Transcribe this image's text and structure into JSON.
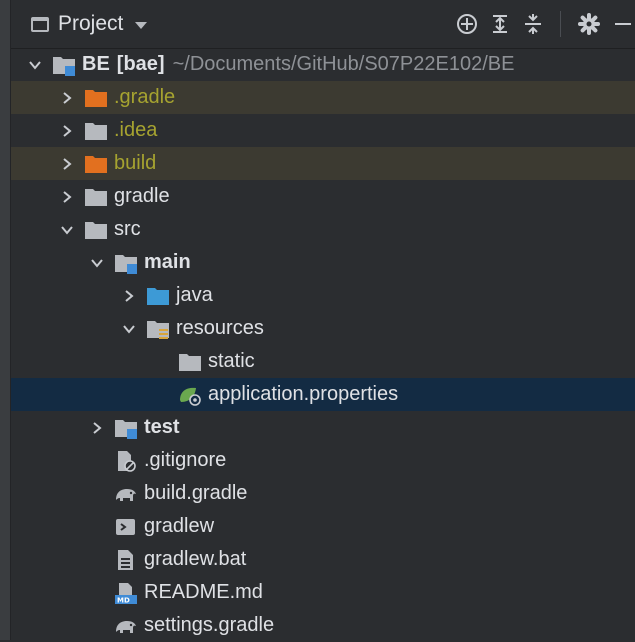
{
  "header": {
    "title": "Project"
  },
  "colors": {
    "folder_gray": "#b6b9be",
    "folder_orange": "#e2701f",
    "folder_blue": "#3d9ad6",
    "module_blue": "#3f8bd6",
    "excluded_row": "#3c3a31",
    "selected_row": "#132b43",
    "excluded_text": "#a6a330"
  },
  "tree": {
    "root_name": "BE",
    "root_module": "[bae]",
    "root_path": "~/Documents/GitHub/S07P22E102/BE",
    "gradle_hidden": ".gradle",
    "idea": ".idea",
    "build_dir": "build",
    "gradle_dir": "gradle",
    "src": "src",
    "main": "main",
    "java": "java",
    "resources": "resources",
    "static": "static",
    "app_props": "application.properties",
    "test": "test",
    "gitignore": ".gitignore",
    "build_gradle": "build.gradle",
    "gradlew": "gradlew",
    "gradlew_bat": "gradlew.bat",
    "readme": "README.md",
    "settings_gradle": "settings.gradle"
  },
  "icons": {
    "locate": "crosshair-icon",
    "expand_all": "expand-all-icon",
    "collapse_all": "collapse-all-icon",
    "settings": "gear-icon",
    "hide": "minimize-icon"
  }
}
